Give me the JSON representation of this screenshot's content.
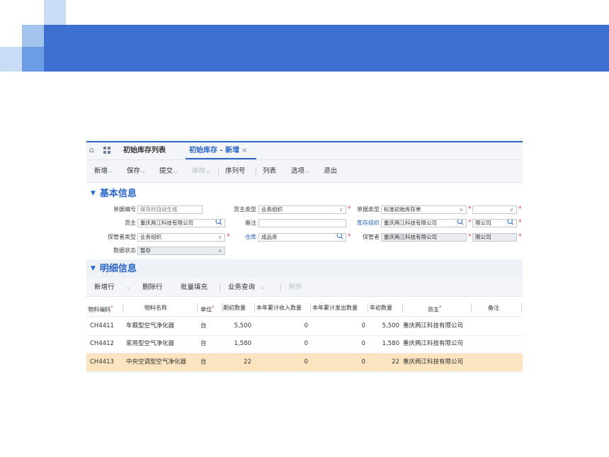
{
  "tabs": {
    "list_label": "初始库存列表",
    "active_label": "初始库存 - 新增",
    "close_glyph": "×"
  },
  "toolbar": {
    "items": [
      "新增",
      "保存",
      "提交",
      "审核",
      "序列号",
      "列表",
      "选项",
      "退出"
    ]
  },
  "basic_section": {
    "title": "基本信息",
    "bill_no": {
      "label": "单据编号",
      "placeholder": "保存时自动生成"
    },
    "owner_type": {
      "label": "货主类型",
      "value": "业务组织"
    },
    "bill_type": {
      "label": "单据类型",
      "value": "标准初始库存单"
    },
    "extra_field_1": {
      "value": ""
    },
    "owner": {
      "label": "货主",
      "value": "重庆两江科技有限公司"
    },
    "remark": {
      "label": "备注",
      "value": ""
    },
    "stock_org": {
      "label": "库存组织",
      "value": "重庆两江科技有限公司"
    },
    "extra_field_2": {
      "value": "限公司"
    },
    "keeper_type": {
      "label": "保管者类型",
      "value": "业务组织"
    },
    "warehouse": {
      "label": "仓库",
      "value": "成品库"
    },
    "keeper": {
      "label": "保管者",
      "value": "重庆两江科技有限公司"
    },
    "extra_field_3": {
      "value": "限公司"
    },
    "status": {
      "label": "数据状态",
      "value": "暂存"
    }
  },
  "detail_section": {
    "title": "明细信息",
    "toolbar": [
      "新增行",
      "删除行",
      "批量填充",
      "业务查询",
      "附件"
    ],
    "columns": [
      "物料编码",
      "物料名称",
      "单位",
      "期初数量",
      "本年累计收入数量",
      "本年累计发出数量",
      "年初数量",
      "货主",
      "备注"
    ],
    "rows": [
      {
        "code": "CH4411",
        "name": "车载型空气净化器",
        "unit": "台",
        "opening": "5,500",
        "in": "0",
        "out": "0",
        "year_start": "5,500",
        "owner": "重庆两江科技有限公司",
        "remark": ""
      },
      {
        "code": "CH4412",
        "name": "家用型空气净化器",
        "unit": "台",
        "opening": "1,580",
        "in": "0",
        "out": "0",
        "year_start": "1,580",
        "owner": "重庆两江科技有限公司",
        "remark": ""
      },
      {
        "code": "CH4413",
        "name": "中央空调型空气净化器",
        "unit": "台",
        "opening": "22",
        "in": "0",
        "out": "0",
        "year_start": "22",
        "owner": "重庆两江科技有限公司",
        "remark": ""
      }
    ],
    "selected_row": 2
  },
  "colors": {
    "banner": "#3d6fd0",
    "accent": "#2a66c7",
    "required": "#e03b3b",
    "selected_row": "#fbe4bf"
  }
}
